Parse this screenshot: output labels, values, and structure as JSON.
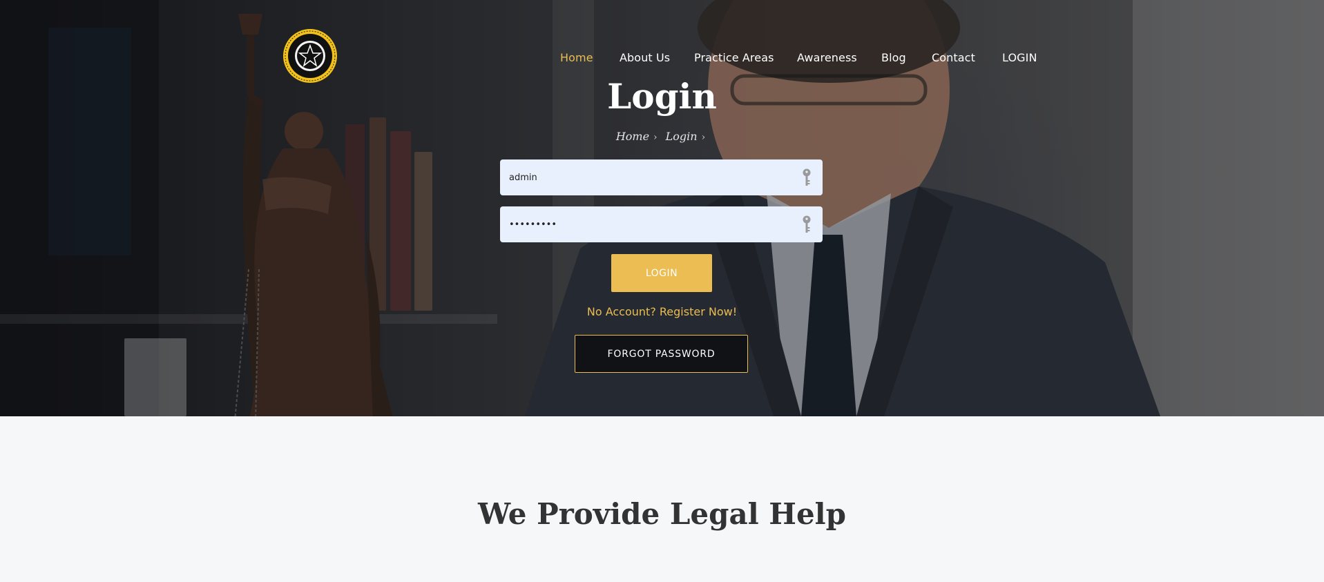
{
  "nav": {
    "items": [
      {
        "label": "Home",
        "active": true
      },
      {
        "label": "About Us"
      },
      {
        "label": "Practice Areas"
      },
      {
        "label": "Awareness"
      },
      {
        "label": "Blog"
      },
      {
        "label": "Contact"
      },
      {
        "label": "LOGIN"
      }
    ]
  },
  "hero": {
    "title": "Login",
    "breadcrumb": [
      "Home",
      "Login"
    ]
  },
  "form": {
    "username_value": "admin",
    "password_value": "•••••••••",
    "login_label": "LOGIN",
    "register_text": "No Account? Register Now!",
    "forgot_label": "FORGOT PASSWORD"
  },
  "section": {
    "title": "We Provide Legal Help"
  },
  "colors": {
    "accent": "#ebbd52",
    "field_bg": "#e8f0fe",
    "section_bg": "#f6f7f9",
    "heading": "#333333"
  },
  "icons": [
    "logo-seal-icon",
    "key-icon",
    "chevron-right-icon"
  ]
}
